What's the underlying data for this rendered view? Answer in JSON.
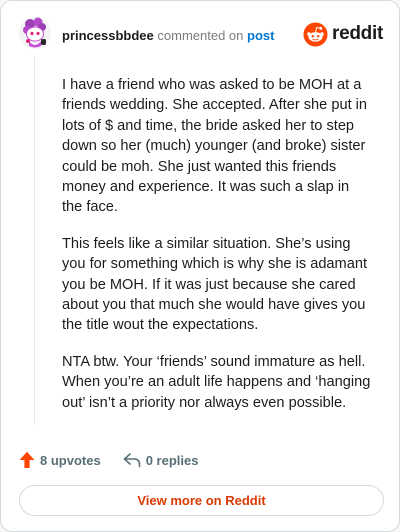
{
  "comment": {
    "username": "princessbbdee",
    "commented_text": "commented on",
    "post_link": "post",
    "paragraphs": [
      "I have a friend who was asked to be MOH at a friends wedding. She accepted. After she put in lots of $ and time, the bride asked her to step down so her (much) younger (and broke) sister could be moh. She just wanted this friends money and experience. It was such a slap in the face.",
      "This feels like a similar situation. She’s using you for something which is why she is adamant you be MOH. If it was just because she cared about you that much she would have gives you the title wout the expectations.",
      "NTA btw. Your ‘friends’ sound immature as hell. When you’re an adult life happens and ‘hanging out’ isn’t a priority nor always even possible."
    ]
  },
  "brand": {
    "wordmark": "reddit",
    "color": "#ff4500",
    "icon": "reddit-logo-icon"
  },
  "actions": {
    "upvotes": "8 upvotes",
    "upvote_icon": "upvote-arrow-icon",
    "upvote_color": "#ff4500",
    "replies": "0 replies",
    "reply_icon": "reply-arrow-icon"
  },
  "footer": {
    "view_more_label": "View more on Reddit",
    "view_more_color": "#d93a00"
  }
}
